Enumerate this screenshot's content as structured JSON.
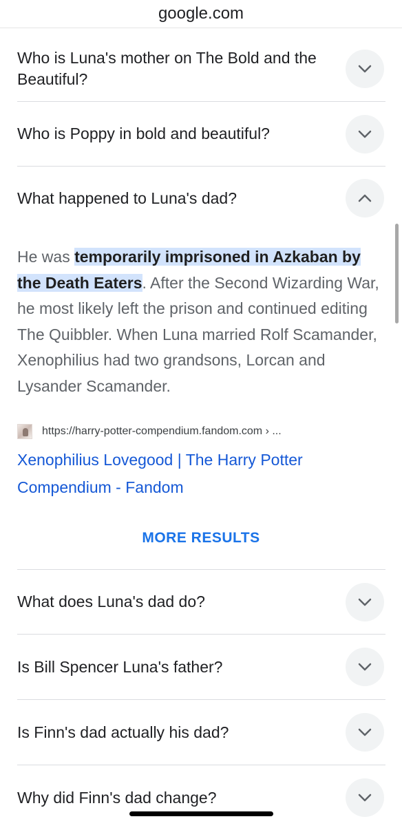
{
  "browser": {
    "url": "google.com"
  },
  "questions_top": [
    {
      "label": "Who is Luna's mother on The Bold and the Beautiful?",
      "expanded": false
    },
    {
      "label": "Who is Poppy in bold and beautiful?",
      "expanded": false
    },
    {
      "label": "What happened to Luna's dad?",
      "expanded": true
    }
  ],
  "answer": {
    "prefix": "He was ",
    "highlight": "temporarily imprisoned in Azkaban by the Death Eaters",
    "rest": ". After the Second Wizarding War, he most likely left the prison and continued editing The Quibbler. When Luna married Rolf Scamander, Xenophilius had two grandsons, Lorcan and Lysander Scamander.",
    "source_url": "https://harry-potter-compendium.fandom.com › ...",
    "source_title": "Xenophilius Lovegood | The Harry Potter Compendium - Fandom"
  },
  "more_results_label": "MORE RESULTS",
  "questions_bottom": [
    {
      "label": "What does Luna's dad do?",
      "expanded": false
    },
    {
      "label": "Is Bill Spencer Luna's father?",
      "expanded": false
    },
    {
      "label": "Is Finn's dad actually his dad?",
      "expanded": false
    },
    {
      "label": "Why did Finn's dad change?",
      "expanded": false
    }
  ],
  "icons": {
    "collapsed": "chevron-down-icon",
    "expanded": "chevron-up-icon",
    "source": "site-favicon-icon"
  },
  "colors": {
    "link": "#1558d6",
    "highlight": "#d2e3fc",
    "more_results": "#1a73e8",
    "chevron_bg": "#f1f3f4"
  }
}
